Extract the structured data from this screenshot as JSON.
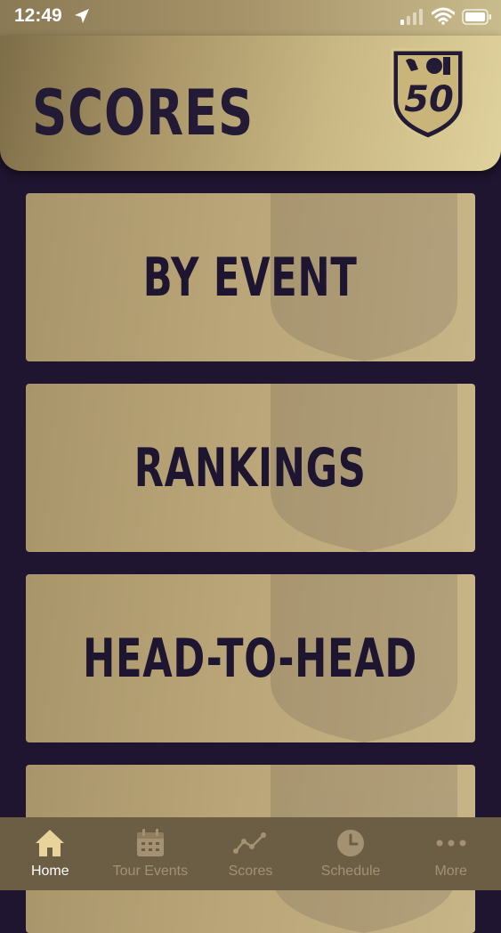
{
  "status_bar": {
    "time": "12:49"
  },
  "header": {
    "title": "SCORES",
    "logo_text": "50"
  },
  "menu": [
    {
      "label": "BY EVENT"
    },
    {
      "label": "RANKINGS"
    },
    {
      "label": "HEAD-TO-HEAD"
    },
    {
      "label": ""
    }
  ],
  "tab_bar": {
    "tabs": [
      {
        "label": "Home",
        "icon": "home-icon",
        "active": true
      },
      {
        "label": "Tour Events",
        "icon": "calendar-icon",
        "active": false
      },
      {
        "label": "Scores",
        "icon": "chart-line-icon",
        "active": false
      },
      {
        "label": "Schedule",
        "icon": "clock-icon",
        "active": false
      },
      {
        "label": "More",
        "icon": "more-dots-icon",
        "active": false
      }
    ]
  },
  "colors": {
    "background": "#1f1530",
    "gold": "#b9a577",
    "dark_text": "#231a35",
    "tab_bar": "#6b5e45",
    "tab_inactive": "#a49172",
    "tab_active": "#ffffff"
  }
}
